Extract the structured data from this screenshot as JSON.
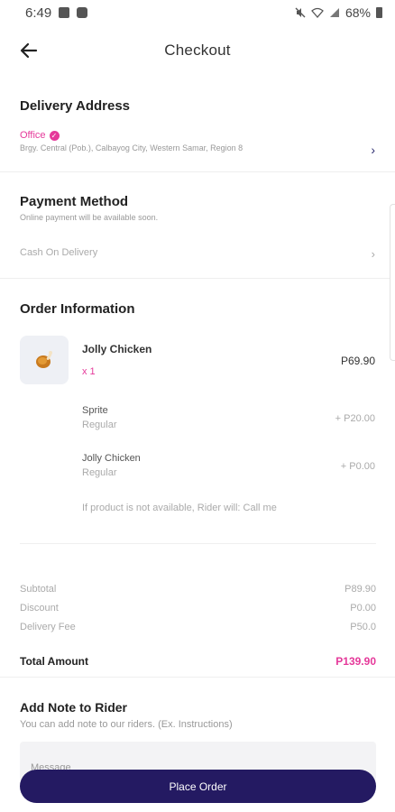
{
  "status_bar": {
    "time": "6:49",
    "battery": "68%"
  },
  "header": {
    "title": "Checkout"
  },
  "delivery": {
    "section_title": "Delivery Address",
    "label": "Office",
    "address": "Brgy. Central (Pob.), Calbayog City, Western Samar, Region 8"
  },
  "payment": {
    "section_title": "Payment Method",
    "subtitle": "Online payment will be available soon.",
    "selected": "Cash On Delivery"
  },
  "order": {
    "section_title": "Order Information",
    "product": {
      "name": "Jolly Chicken",
      "quantity": "x 1",
      "price": "P69.90"
    },
    "addons": [
      {
        "name": "Sprite",
        "variant": "Regular",
        "price": "+ P20.00"
      },
      {
        "name": "Jolly Chicken",
        "variant": "Regular",
        "price": "+ P0.00"
      }
    ],
    "availability_note": "If product is not available, Rider will: Call me"
  },
  "summary": {
    "subtotal_label": "Subtotal",
    "subtotal_value": "P89.90",
    "discount_label": "Discount",
    "discount_value": "P0.00",
    "delivery_fee_label": "Delivery Fee",
    "delivery_fee_value": "P50.0",
    "total_label": "Total Amount",
    "total_value": "P139.90"
  },
  "note": {
    "title": "Add Note to Rider",
    "subtitle": "You can add note to our riders. (Ex. Instructions)",
    "placeholder": "Message"
  },
  "actions": {
    "place_order": "Place Order"
  },
  "colors": {
    "accent_pink": "#e5399a",
    "primary_button": "#241a62"
  },
  "icons": {
    "back": "arrow-left-icon",
    "verified": "check-badge-icon",
    "chevron": "chevron-right-icon",
    "product": "fried-chicken-icon"
  }
}
